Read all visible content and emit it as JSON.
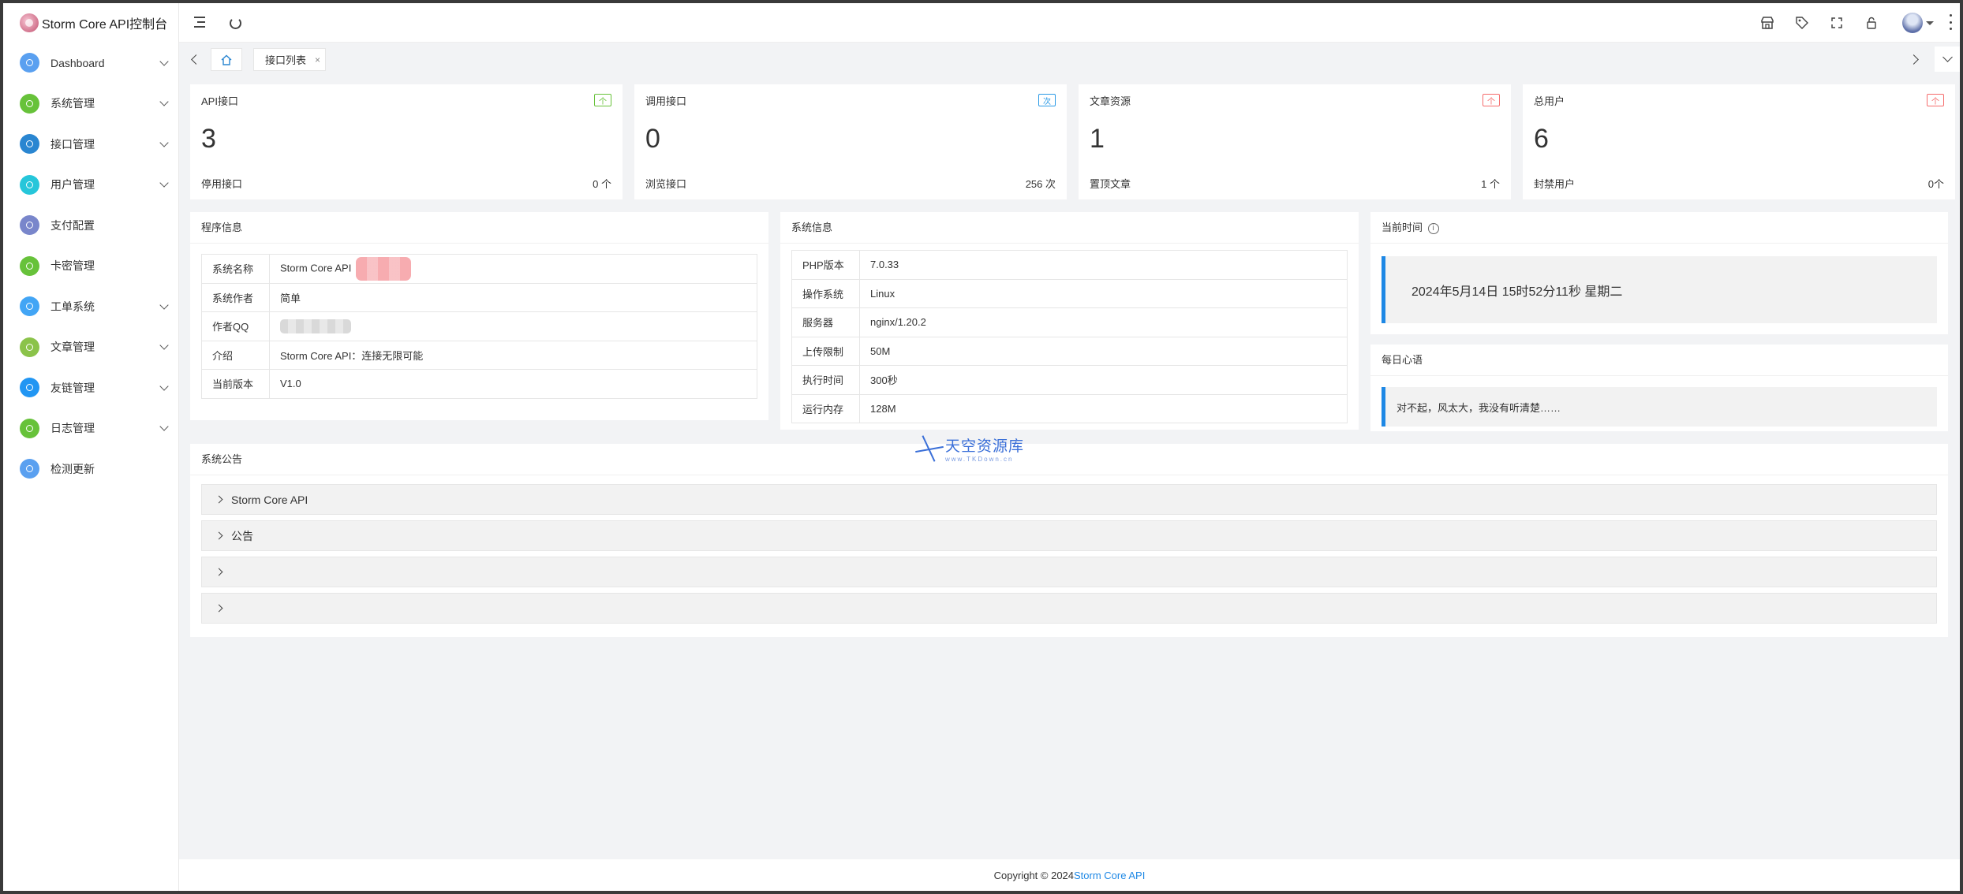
{
  "app": {
    "title": "Storm Core API控制台"
  },
  "sidebar": {
    "items": [
      {
        "label": "Dashboard",
        "icon": "dashboard-icon",
        "color": "#5aa0f0",
        "expandable": true
      },
      {
        "label": "系统管理",
        "icon": "settings-icon",
        "color": "#67c23a",
        "expandable": true
      },
      {
        "label": "接口管理",
        "icon": "api-icon",
        "color": "#2a86d1",
        "expandable": true
      },
      {
        "label": "用户管理",
        "icon": "user-icon",
        "color": "#26c6da",
        "expandable": true
      },
      {
        "label": "支付配置",
        "icon": "payment-icon",
        "color": "#7986cb",
        "expandable": false
      },
      {
        "label": "卡密管理",
        "icon": "card-icon",
        "color": "#67c23a",
        "expandable": false
      },
      {
        "label": "工单系统",
        "icon": "ticket-icon",
        "color": "#42a5f5",
        "expandable": true
      },
      {
        "label": "文章管理",
        "icon": "article-icon",
        "color": "#8bc34a",
        "expandable": true
      },
      {
        "label": "友链管理",
        "icon": "link-icon",
        "color": "#2196f3",
        "expandable": true
      },
      {
        "label": "日志管理",
        "icon": "log-icon",
        "color": "#67c23a",
        "expandable": true
      },
      {
        "label": "检测更新",
        "icon": "update-icon",
        "color": "#5aa0f0",
        "expandable": false
      }
    ]
  },
  "tabs": [
    {
      "label": "接口列表",
      "close": "×"
    }
  ],
  "stats": [
    {
      "title": "API接口",
      "badge": "个",
      "badge_color": "#67c23a",
      "value": "3",
      "sub_label": "停用接口",
      "sub_value": "0 个"
    },
    {
      "title": "调用接口",
      "badge": "次",
      "badge_color": "#2a9ae6",
      "value": "0",
      "sub_label": "浏览接口",
      "sub_value": "256 次"
    },
    {
      "title": "文章资源",
      "badge": "个",
      "badge_color": "#f56c6c",
      "value": "1",
      "sub_label": "置顶文章",
      "sub_value": "1 个"
    },
    {
      "title": "总用户",
      "badge": "个",
      "badge_color": "#f56c6c",
      "value": "6",
      "sub_label": "封禁用户",
      "sub_value": "0个"
    }
  ],
  "program_info": {
    "title": "程序信息",
    "rows": [
      {
        "key": "系统名称",
        "value": "Storm Core API"
      },
      {
        "key": "系统作者",
        "value": "简单"
      },
      {
        "key": "作者QQ",
        "value": ""
      },
      {
        "key": "介绍",
        "value": "Storm Core API：连接无限可能"
      },
      {
        "key": "当前版本",
        "value": "V1.0"
      }
    ]
  },
  "system_info": {
    "title": "系统信息",
    "rows": [
      {
        "key": "PHP版本",
        "value": "7.0.33"
      },
      {
        "key": "操作系统",
        "value": "Linux"
      },
      {
        "key": "服务器",
        "value": "nginx/1.20.2"
      },
      {
        "key": "上传限制",
        "value": "50M"
      },
      {
        "key": "执行时间",
        "value": "300秒"
      },
      {
        "key": "运行内存",
        "value": "128M"
      }
    ]
  },
  "current_time": {
    "title": "当前时间",
    "value": "2024年5月14日 15时52分11秒 星期二"
  },
  "daily_quote": {
    "title": "每日心语",
    "value": "对不起，风太大，我没有听清楚……"
  },
  "announcements": {
    "title": "系统公告",
    "items": [
      "Storm Core API",
      "公告",
      "",
      ""
    ]
  },
  "watermark": {
    "text": "天空资源库",
    "sub": "www.TKDown.cn"
  },
  "footer": {
    "prefix": "Copyright © 2024",
    "link": "Storm Core API"
  }
}
